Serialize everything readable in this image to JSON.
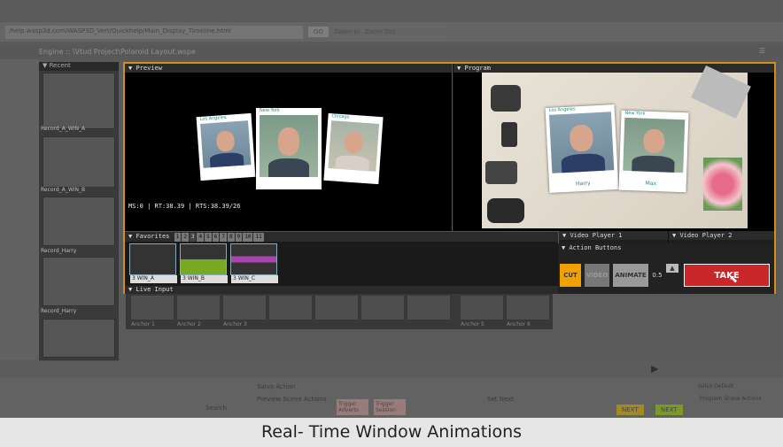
{
  "browser": {
    "url": "/help.wasp3d.com/WASP3D_Vert/Quickhelp/Main_Display_Timeline.html",
    "go_label": "GO",
    "zoom_in": "Zoom In",
    "zoom_out": "Zoom Out"
  },
  "engine": {
    "title": "Engine :: \\Vtud Project\\Polaroid Layout.wspe"
  },
  "recent": {
    "header": "Recent",
    "items": [
      "Record_A_WIN_A",
      "Record_A_WIN_B",
      "Record_Harry",
      "Record_Harry"
    ]
  },
  "preview": {
    "header": "Preview",
    "status": "MS:0  |  RT:38.39  |  RTS:38.39/26",
    "captions": [
      "Los Angeles",
      "New York",
      "Chicago"
    ]
  },
  "program": {
    "header": "Program",
    "captions": [
      "Los Angeles",
      "New York"
    ],
    "names": [
      "Harry",
      "Max"
    ]
  },
  "favorites": {
    "header": "Favorites",
    "tabs": [
      "1",
      "2",
      "3",
      "4",
      "5",
      "6",
      "7",
      "8",
      "9",
      "10",
      "11"
    ],
    "items": [
      "3 WIN_A",
      "3 WIN_B",
      "3 WIN_C"
    ]
  },
  "video_player_1": {
    "header": "Video Player 1"
  },
  "video_player_2": {
    "header": "Video Player 2"
  },
  "action_buttons": {
    "header": "Action Buttons",
    "cut": "CUT",
    "video": "VIDEO",
    "animate": "ANIMATE",
    "duration": "0.5",
    "take": "TAKE"
  },
  "live_input": {
    "header": "Live Input",
    "labels": [
      "Anchor 1",
      "Anchor 2",
      "Anchor 3",
      "",
      "",
      "",
      "Anchor 5",
      "Anchor 6"
    ]
  },
  "bottom": {
    "salvo": "Salvo Action",
    "preview_scene_actions": "Preview Scene Actions",
    "trigger_adverts": "Trigger Adverts",
    "trigger_session": "Trigger Session",
    "set_next": "Set Next",
    "next1": "NEXT",
    "next2": "NEXT",
    "salvo_default": "Salvo Default",
    "program_scene_actions": "Program Scene Actions",
    "search": "Search"
  },
  "caption": "Real- Time Window Animations",
  "colors": {
    "accent": "#d68c1a",
    "cut": "#f0a000",
    "take": "#c8282a"
  }
}
